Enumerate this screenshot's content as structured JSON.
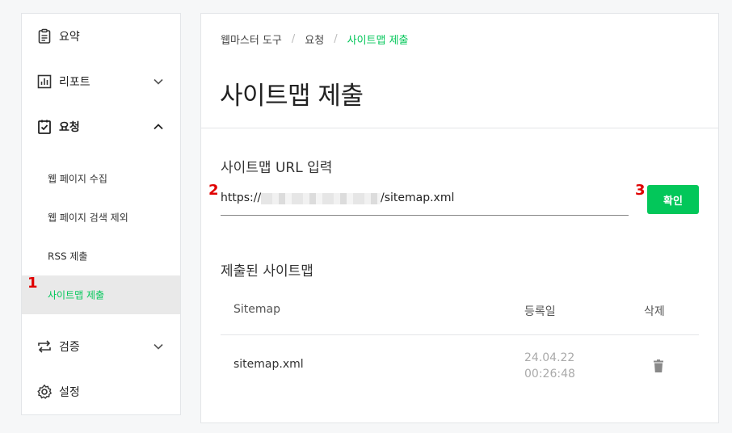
{
  "sidebar": {
    "items": [
      {
        "label": "요약",
        "icon": "clipboard-icon"
      },
      {
        "label": "리포트",
        "icon": "bar-chart-icon"
      },
      {
        "label": "요청",
        "icon": "clipboard-check-icon"
      },
      {
        "label": "검증",
        "icon": "repeat-arrows-icon"
      },
      {
        "label": "설정",
        "icon": "gear-icon"
      }
    ],
    "sub_items": [
      {
        "label": "웹 페이지 수집"
      },
      {
        "label": "웹 페이지 검색 제외"
      },
      {
        "label": "RSS 제출"
      },
      {
        "label": "사이트맵 제출"
      }
    ]
  },
  "breadcrumb": [
    "웹마스터 도구",
    "요청",
    "사이트맵 제출"
  ],
  "page_title": "사이트맵 제출",
  "url_section": {
    "title": "사이트맵 URL 입력",
    "value_prefix": "https://",
    "value_suffix": "/sitemap.xml",
    "confirm_label": "확인"
  },
  "submitted": {
    "title": "제출된 사이트맵",
    "columns": [
      "Sitemap",
      "등록일",
      "삭제"
    ],
    "rows": [
      {
        "sitemap": "sitemap.xml",
        "date": "24.04.22 00:26:48"
      }
    ]
  },
  "markers": [
    "1",
    "2",
    "3"
  ],
  "colors": {
    "accent": "#03c75a",
    "marker": "#e00000"
  }
}
